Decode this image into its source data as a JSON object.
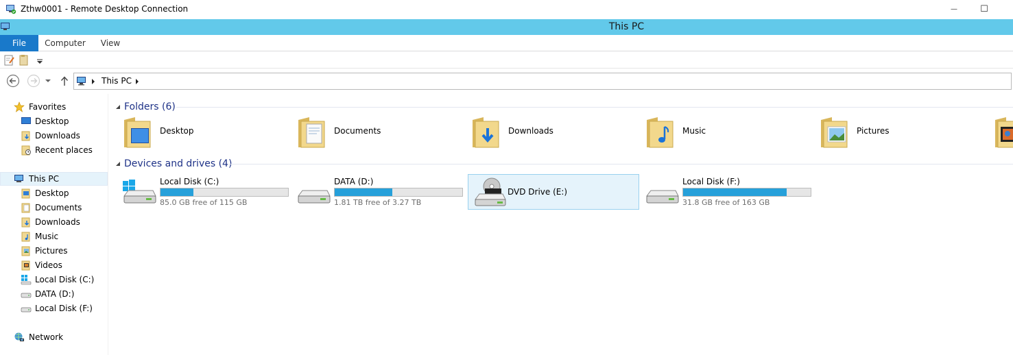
{
  "rdp": {
    "title": "Zthw0001 - Remote Desktop Connection",
    "minimize_glyph": "—",
    "maximize_glyph": "☐"
  },
  "explorer": {
    "title": "This PC"
  },
  "ribbon": {
    "tabs": [
      "File",
      "Computer",
      "View"
    ]
  },
  "address": {
    "crumbs": [
      "This PC"
    ]
  },
  "nav": {
    "favorites": {
      "label": "Favorites",
      "items": [
        "Desktop",
        "Downloads",
        "Recent places"
      ]
    },
    "this_pc": {
      "label": "This PC",
      "items": [
        "Desktop",
        "Documents",
        "Downloads",
        "Music",
        "Pictures",
        "Videos",
        "Local Disk (C:)",
        "DATA (D:)",
        "Local Disk (F:)"
      ]
    },
    "network": {
      "label": "Network"
    }
  },
  "folders_group": {
    "title": "Folders (6)",
    "items": [
      "Desktop",
      "Documents",
      "Downloads",
      "Music",
      "Pictures"
    ]
  },
  "drives_group": {
    "title": "Devices and drives (4)",
    "items": [
      {
        "name": "Local Disk (C:)",
        "free": "85.0 GB free of 115 GB",
        "used_fraction": 0.26
      },
      {
        "name": "DATA (D:)",
        "free": "1.81 TB free of 3.27 TB",
        "used_fraction": 0.45
      },
      {
        "name": "DVD Drive (E:)",
        "free": "",
        "used_fraction": null
      },
      {
        "name": "Local Disk (F:)",
        "free": "31.8 GB free of 163 GB",
        "used_fraction": 0.81
      }
    ]
  },
  "colors": {
    "accent": "#1979ca",
    "titlebar": "#62c9ea",
    "usage_bar": "#26a0da",
    "group_header": "#1e3287"
  }
}
